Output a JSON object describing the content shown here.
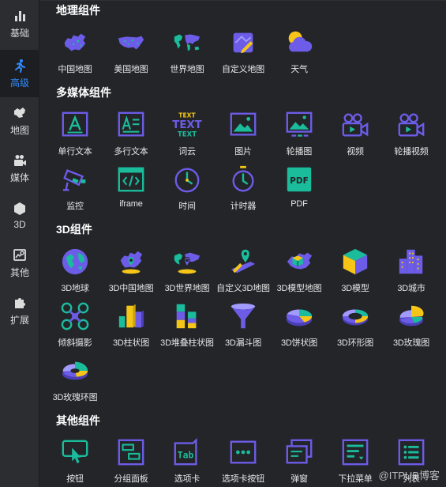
{
  "sidebar": {
    "items": [
      {
        "label": "基础",
        "icon": "bar-chart-icon"
      },
      {
        "label": "高级",
        "icon": "running-person-icon",
        "active": true
      },
      {
        "label": "地图",
        "icon": "map-icon"
      },
      {
        "label": "媒体",
        "icon": "video-camera-icon"
      },
      {
        "label": "3D",
        "icon": "hexagon-icon"
      },
      {
        "label": "其他",
        "icon": "image-search-icon"
      },
      {
        "label": "扩展",
        "icon": "puzzle-icon"
      }
    ]
  },
  "sections": {
    "map": {
      "title": "地理组件",
      "items": [
        {
          "label": "中国地图",
          "icon": "china-map-icon"
        },
        {
          "label": "美国地图",
          "icon": "usa-map-icon"
        },
        {
          "label": "世界地图",
          "icon": "world-map-icon"
        },
        {
          "label": "自定义地图",
          "icon": "custom-map-icon"
        },
        {
          "label": "天气",
          "icon": "weather-icon"
        }
      ]
    },
    "media": {
      "title": "多媒体组件",
      "items": [
        {
          "label": "单行文本",
          "icon": "single-line-text-icon"
        },
        {
          "label": "多行文本",
          "icon": "multi-line-text-icon"
        },
        {
          "label": "词云",
          "icon": "word-cloud-icon",
          "glyph": "TEXT"
        },
        {
          "label": "图片",
          "icon": "picture-icon"
        },
        {
          "label": "轮播图",
          "icon": "carousel-icon"
        },
        {
          "label": "视频",
          "icon": "video-icon"
        },
        {
          "label": "轮播视频",
          "icon": "carousel-video-icon"
        },
        {
          "label": "监控",
          "icon": "surveillance-camera-icon"
        },
        {
          "label": "iframe",
          "icon": "iframe-icon"
        },
        {
          "label": "时间",
          "icon": "clock-icon"
        },
        {
          "label": "计时器",
          "icon": "stopwatch-icon"
        },
        {
          "label": "PDF",
          "icon": "pdf-icon",
          "glyph": "PDF"
        }
      ]
    },
    "three_d": {
      "title": "3D组件",
      "items": [
        {
          "label": "3D地球",
          "icon": "globe-3d-icon"
        },
        {
          "label": "3D中国地图",
          "icon": "china-map-3d-icon"
        },
        {
          "label": "3D世界地图",
          "icon": "world-map-3d-icon"
        },
        {
          "label": "自定义3D地图",
          "icon": "custom-map-3d-icon"
        },
        {
          "label": "3D模型地图",
          "icon": "model-map-3d-icon"
        },
        {
          "label": "3D模型",
          "icon": "cube-3d-icon"
        },
        {
          "label": "3D城市",
          "icon": "city-3d-icon"
        },
        {
          "label": "倾斜摄影",
          "icon": "drone-icon"
        },
        {
          "label": "3D柱状图",
          "icon": "bar-chart-3d-icon"
        },
        {
          "label": "3D堆叠柱状图",
          "icon": "stacked-bar-3d-icon"
        },
        {
          "label": "3D漏斗图",
          "icon": "funnel-3d-icon"
        },
        {
          "label": "3D饼状图",
          "icon": "pie-3d-icon"
        },
        {
          "label": "3D环形图",
          "icon": "ring-3d-icon"
        },
        {
          "label": "3D玫瑰图",
          "icon": "rose-3d-icon"
        },
        {
          "label": "3D玫瑰环图",
          "icon": "rose-ring-3d-icon"
        }
      ]
    },
    "other": {
      "title": "其他组件",
      "items": [
        {
          "label": "按钮",
          "icon": "button-icon"
        },
        {
          "label": "分组面板",
          "icon": "group-panel-icon"
        },
        {
          "label": "选项卡",
          "icon": "tab-icon",
          "glyph": "Tab"
        },
        {
          "label": "选项卡按钮",
          "icon": "tab-button-icon"
        },
        {
          "label": "弹窗",
          "icon": "popup-icon"
        },
        {
          "label": "下拉菜单",
          "icon": "dropdown-menu-icon"
        },
        {
          "label": "列表",
          "icon": "list-icon"
        }
      ]
    }
  },
  "watermark": "@ITPUB博客",
  "colors": {
    "primary": "#6c5ce7",
    "accent_teal": "#1abc9c",
    "active_blue": "#2f8cff",
    "yellow": "#f5c518"
  }
}
